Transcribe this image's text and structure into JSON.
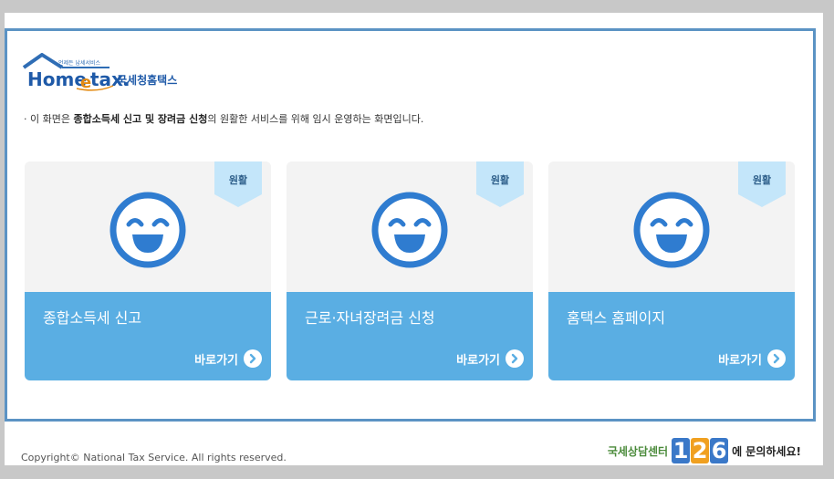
{
  "logo": {
    "small_text": "언제든 납세서비스",
    "brand_en_home": "Home",
    "brand_en_e": "e",
    "brand_en_tax": "tax.",
    "brand_ko": "국세청홈택스"
  },
  "notice": {
    "prefix": "· 이 화면은 ",
    "emphasis": "종합소득세 신고 및 장려금 신청",
    "suffix": "의 원활한 서비스를 위해 임시 운영하는 화면입니다."
  },
  "cards": [
    {
      "title": "종합소득세 신고",
      "badge": "원활",
      "link_label": "바로가기"
    },
    {
      "title": "근로·자녀장려금 신청",
      "badge": "원활",
      "link_label": "바로가기"
    },
    {
      "title": "홈택스 홈페이지",
      "badge": "원활",
      "link_label": "바로가기"
    }
  ],
  "footer": {
    "copyright": "Copyright© National Tax Service. All rights reserved.",
    "helpline_label": "국세상담센터",
    "helpline_digits": [
      "1",
      "2",
      "6"
    ],
    "helpline_tail": "에 문의하세요!"
  },
  "colors": {
    "frame_border": "#5b93c4",
    "card_bottom": "#5aaee3",
    "card_top": "#f3f3f3",
    "face_blue": "#2f7cd0",
    "badge_bg": "#c4e6fa",
    "digit_colors": [
      "#3a78c8",
      "#f0a020",
      "#3a78c8"
    ]
  },
  "icons": {
    "status": "smiley-face-icon",
    "link": "chevron-right-circle-icon",
    "logo_house": "house-roof-icon"
  }
}
